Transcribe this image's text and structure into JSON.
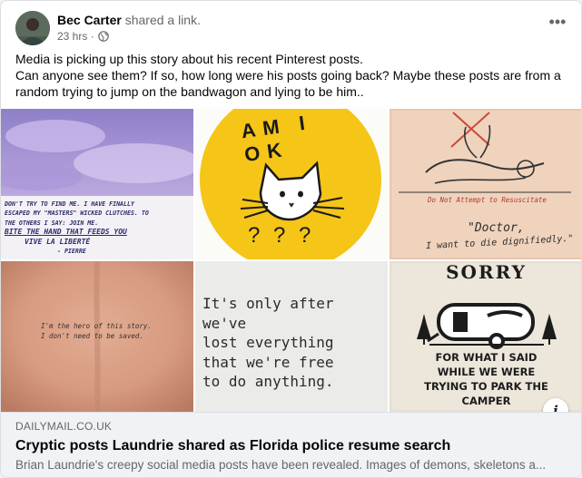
{
  "post": {
    "author": "Bec Carter",
    "action": "shared a link.",
    "time": "23 hrs",
    "separator": "·",
    "more_icon": "ellipsis-icon",
    "privacy_icon": "globe-icon",
    "text_lines": [
      "Media is picking up this story about his recent Pinterest posts.",
      "Can anyone see them? If so, how long were his posts going back? Maybe these posts are from a",
      "random trying to jump on the bandwagon and lying to be him.."
    ]
  },
  "images": {
    "tile1": {
      "lines": [
        "DON'T TRY TO FIND ME. I HAVE FINALLY",
        "ESCAPED MY \"MASTERS\" WICKED CLUTCHES. TO",
        "THE OTHERS I SAY: JOIN ME.",
        "BITE THE HAND THAT FEEDS YOU",
        "VIVE LA LIBERTÉ",
        "- PIERRE"
      ]
    },
    "tile2": {
      "top_text": "AM I OK",
      "marks": "? ? ?"
    },
    "tile3": {
      "caption": "Do Not Attempt to Resuscitate",
      "quote_line1": "\"Doctor,",
      "quote_line2": "I want to die dignifiedly.\""
    },
    "tile4": {
      "tattoo_line1": "I'm the hero of this story.",
      "tattoo_line2": "I don't need to be saved."
    },
    "tile5": {
      "lines": [
        "It's only after we've",
        "lost everything",
        "that we're free",
        "to do anything."
      ]
    },
    "tile6": {
      "title": "SORRY",
      "lines": [
        "FOR WHAT I SAID",
        "WHILE WE WERE",
        "TRYING TO PARK THE",
        "CAMPER"
      ]
    }
  },
  "link": {
    "domain": "DAILYMAIL.CO.UK",
    "headline": "Cryptic posts Laundrie shared as Florida police resume search",
    "summary": "Brian Laundrie's creepy social media posts have been revealed. Images of demons, skeletons a...",
    "info_label": "i",
    "info_icon": "info-icon"
  },
  "colors": {
    "accent_yellow": "#f5c518",
    "muted_text": "#65676b",
    "preview_bg": "#f0f2f5"
  }
}
